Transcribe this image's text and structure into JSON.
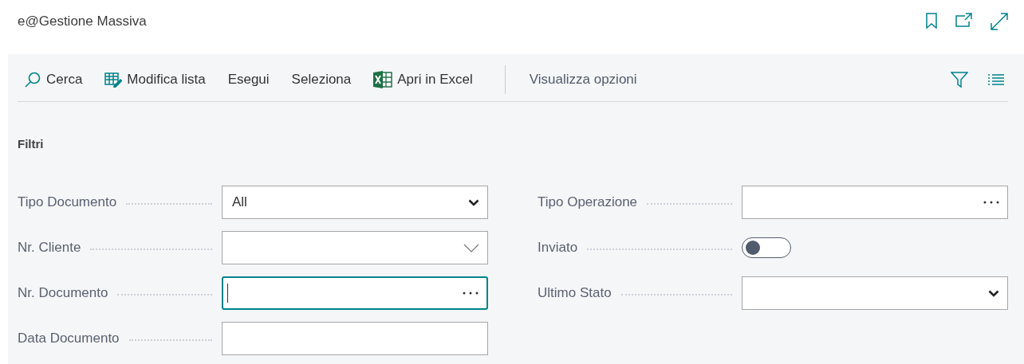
{
  "page": {
    "title": "e@Gestione Massiva"
  },
  "toolbar": {
    "actions": [
      {
        "label": "Cerca",
        "kind": "search"
      },
      {
        "label": "Modifica lista",
        "kind": "edit"
      },
      {
        "label": "Esegui",
        "kind": "plain"
      },
      {
        "label": "Seleziona",
        "kind": "plain"
      },
      {
        "label": "Apri in Excel",
        "kind": "spreadsheet"
      }
    ],
    "view_options": "Visualizza opzioni"
  },
  "filters": {
    "heading": "Filtri",
    "left": [
      {
        "label": "Tipo Documento",
        "kind": "dropdown",
        "value": "All",
        "focused": false
      },
      {
        "label": "Nr. Cliente",
        "kind": "lookup",
        "focused": false
      },
      {
        "label": "Nr. Documento",
        "kind": "assist",
        "focused": true
      },
      {
        "label": "Data Documento",
        "kind": "text",
        "focused": false
      }
    ],
    "right": [
      {
        "label": "Tipo Operazione",
        "kind": "assist",
        "focused": false
      },
      {
        "label": "Inviato",
        "kind": "toggle",
        "on": false
      },
      {
        "label": "Ultimo Stato",
        "kind": "dropdown",
        "focused": false
      }
    ]
  }
}
